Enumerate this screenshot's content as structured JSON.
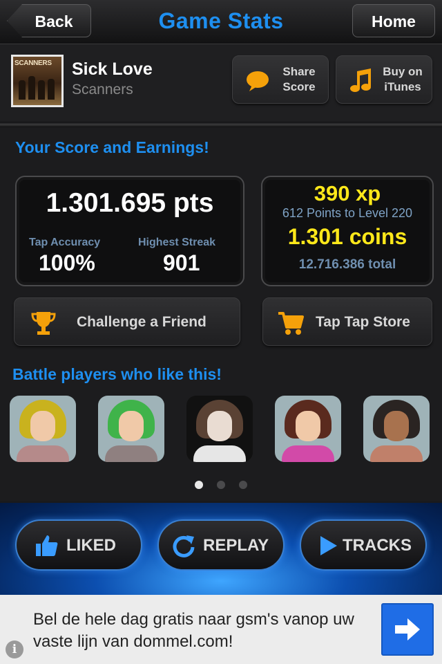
{
  "nav": {
    "back_label": "Back",
    "title": "Game Stats",
    "home_label": "Home"
  },
  "song": {
    "title": "Sick Love",
    "artist": "Scanners",
    "album_art_text": "SCANNERS"
  },
  "header_buttons": {
    "share_label_line1": "Share",
    "share_label_line2": "Score",
    "itunes_label_line1": "Buy on",
    "itunes_label_line2": "iTunes"
  },
  "score": {
    "heading": "Your Score and Earnings!",
    "points": "1.301.695 pts",
    "tap_accuracy_label": "Tap Accuracy",
    "tap_accuracy_value": "100%",
    "highest_streak_label": "Highest Streak",
    "highest_streak_value": "901",
    "xp": "390 xp",
    "level_note": "612 Points to Level 220",
    "coins": "1.301 coins",
    "total": "12.716.386 total"
  },
  "actions": {
    "challenge_label": "Challenge a Friend",
    "store_label": "Tap Tap Store"
  },
  "battle": {
    "heading": "Battle players who like this!",
    "players": [
      {
        "hair_color": "#c9b21e",
        "shirt_color": "#b58a8a"
      },
      {
        "hair_color": "#3fb34a",
        "shirt_color": "#8f8080"
      },
      {
        "hair_color": "#5a4234",
        "shirt_color": "#e6e6e6"
      },
      {
        "hair_color": "#5a2a1e",
        "shirt_color": "#d24aa8"
      },
      {
        "hair_color": "#2a2422",
        "shirt_color": "#c0806a"
      }
    ],
    "page_count": 3,
    "active_page": 1
  },
  "bottom_bar": {
    "liked_label": "LIKED",
    "replay_label": "REPLAY",
    "tracks_label": "TRACKS"
  },
  "ad": {
    "text": "Bel de hele dag gratis naar gsm's vanop uw vaste lijn van dommel.com!",
    "info_glyph": "i"
  },
  "colors": {
    "accent_blue": "#1e8ff0",
    "highlight_yellow": "#ffe81a",
    "icon_orange": "#f5a10a"
  }
}
